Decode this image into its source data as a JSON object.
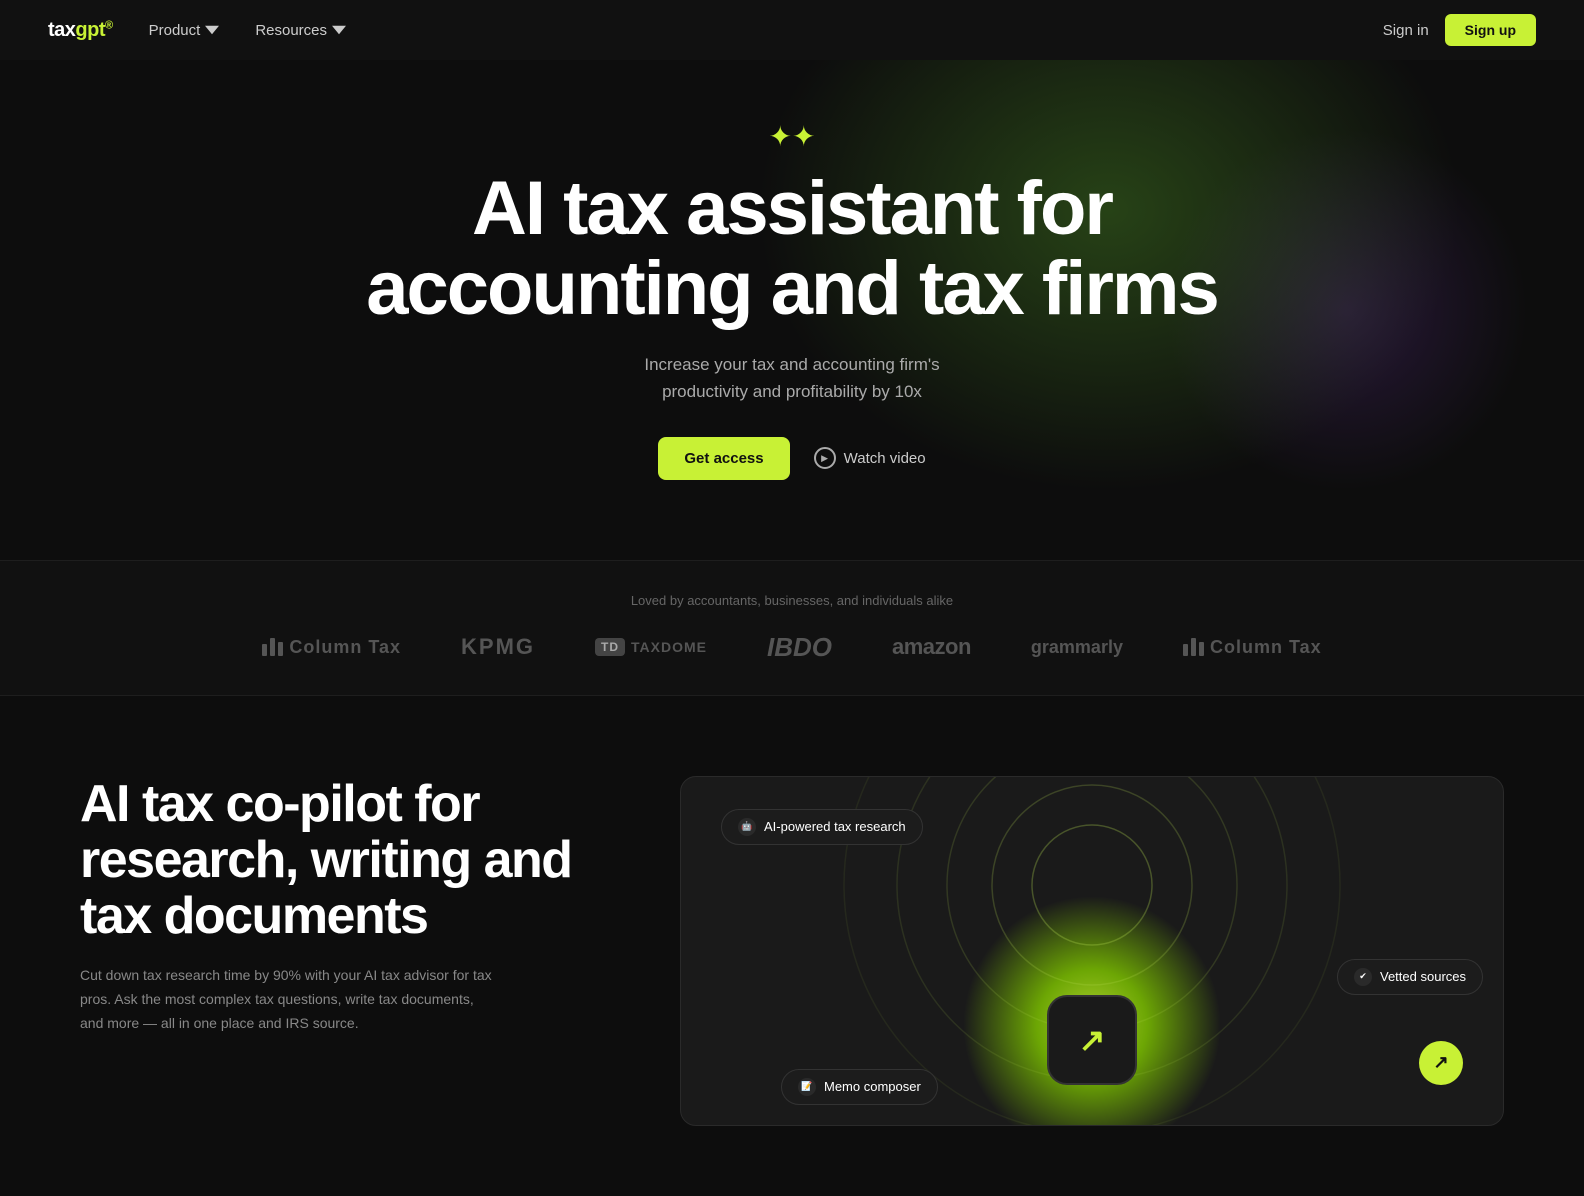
{
  "nav": {
    "logo": "taxgpt",
    "links": [
      {
        "label": "Product",
        "has_chevron": true
      },
      {
        "label": "Resources",
        "has_chevron": true
      }
    ],
    "sign_in": "Sign in",
    "sign_up": "Sign up"
  },
  "hero": {
    "sparkle": "✦✦",
    "title_line1": "AI tax assistant for",
    "title_line2": "accounting and tax firms",
    "subtitle": "Increase your tax and accounting firm's\nproductivity and profitability by 10x",
    "cta_primary": "Get access",
    "cta_secondary": "Watch video"
  },
  "logos": {
    "label": "Loved by accountants, businesses, and individuals alike",
    "items": [
      {
        "name": "Column Tax",
        "type": "bars"
      },
      {
        "name": "KPMG",
        "type": "text"
      },
      {
        "name": "TaxDome",
        "type": "text-prefix",
        "prefix": "TD"
      },
      {
        "name": "IBDO",
        "type": "text"
      },
      {
        "name": "amazon",
        "type": "text"
      },
      {
        "name": "grammarly",
        "type": "text"
      },
      {
        "name": "Column Tax",
        "type": "bars"
      }
    ]
  },
  "feature": {
    "title": "AI tax co-pilot for\nresearch, writing and\ntax documents",
    "desc": "Cut down tax research time by 90% with your AI tax advisor for tax pros. Ask the most complex tax questions, write tax documents, and more — all in one place and IRS source.",
    "visual": {
      "badge_ai": "AI-powered tax research",
      "badge_vetted": "Vetted sources",
      "badge_memo": "Memo composer"
    }
  }
}
